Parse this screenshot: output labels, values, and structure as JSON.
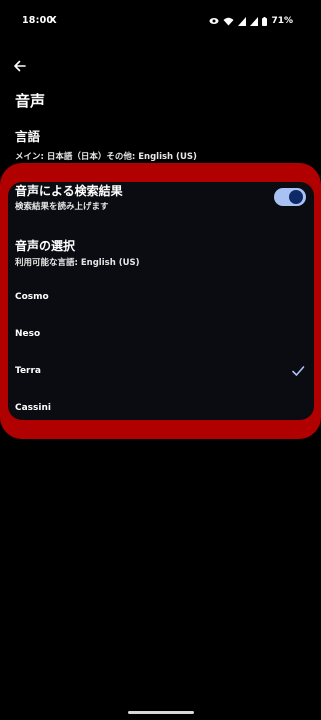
{
  "status_bar": {
    "time": "18:00",
    "app_icon": "X",
    "battery_percent": "71%",
    "icons": [
      "eye-icon",
      "wifi-icon",
      "signal-icon",
      "signal-icon",
      "battery-icon"
    ]
  },
  "header": {
    "title": "音声"
  },
  "language": {
    "title": "言語",
    "subtitle": "メイン: 日本語（日本）その他: English (US)"
  },
  "voice_search_result": {
    "title": "音声による検索結果",
    "subtitle": "検索結果を読み上げます",
    "toggle_on": true
  },
  "voice_selection": {
    "title": "音声の選択",
    "subtitle": "利用可能な言語: English (US)",
    "options": [
      {
        "label": "Cosmo",
        "selected": false
      },
      {
        "label": "Neso",
        "selected": false
      },
      {
        "label": "Terra",
        "selected": true
      },
      {
        "label": "Cassini",
        "selected": false
      }
    ]
  },
  "colors": {
    "background": "#000000",
    "highlight": "#b00000",
    "card": "#0b0c12",
    "toggle_track": "#a8c3f3",
    "toggle_knob": "#0d2a66",
    "check": "#a8c3f3"
  }
}
